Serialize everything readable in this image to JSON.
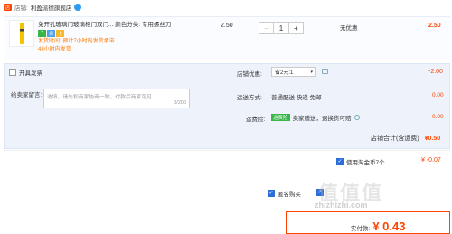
{
  "shop": {
    "label": "店铺:",
    "name": "利盈派德旗舰店"
  },
  "item": {
    "title": "免开孔玻璃门玻璃柜门双门... 颜色分类: 专用螺丝刀",
    "ship_note_1": "发货时间: 预计7小时内发货承诺",
    "ship_note_2": "48小时内发货",
    "price": "2.50",
    "quantity": "1",
    "minus": "−",
    "plus": "+",
    "discount": "无优惠",
    "subtotal": "2.50"
  },
  "options": {
    "anonymous_label": "开具发票",
    "memo_label": "给卖家留言:",
    "memo_placeholder": "选填，请先和商家协商一致，付款后商家可见",
    "memo_count": "0/200",
    "shop_discount_label": "店铺优惠:",
    "shop_discount_value": "省2元:1",
    "shop_discount_amount": "-2.00",
    "shipping_label": "运送方式:",
    "shipping_value": "普通配送 快递 免邮",
    "shipping_amount": "0.00",
    "insurance_label": "运费险:",
    "insurance_tag": "运费险",
    "insurance_value": "卖家赠送，退换货可赔",
    "insurance_amount": "0.00",
    "shop_total_label": "店铺合计(含运费)",
    "shop_total_value": "¥0.50"
  },
  "coupons": {
    "coupon_label": "使用淘金币7个",
    "coupon_value": "¥ -0.07",
    "anonymous_buy": "匿名购买"
  },
  "submit": {
    "paid_label": "实付款:",
    "paid_value": "¥ 0.43"
  },
  "watermark": {
    "site": "zhizhizhi.com",
    "big": "值值值"
  }
}
